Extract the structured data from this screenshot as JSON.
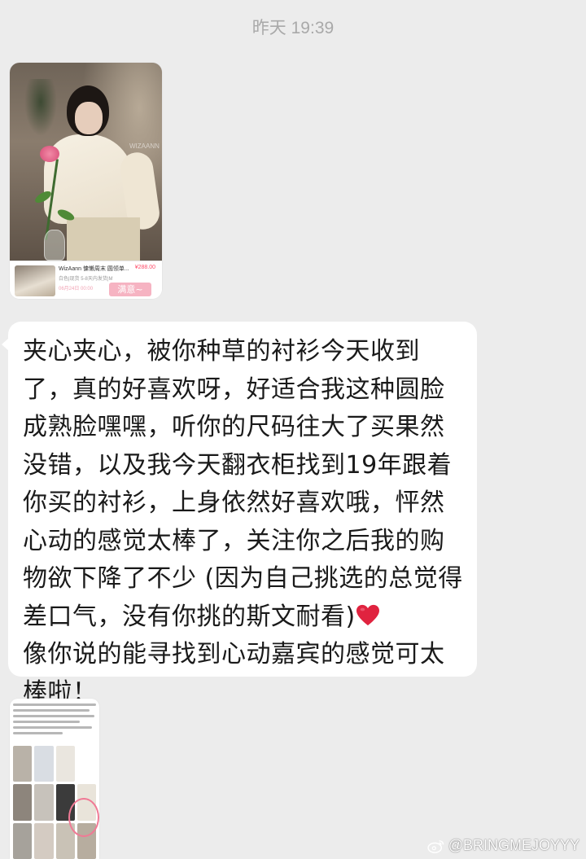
{
  "chat": {
    "timestamp": "昨天 19:39",
    "product_card": {
      "shop_title": "WizAann 慵懒周末 圆领单...",
      "price": "¥288.00",
      "sub_line": "白色|现货 5-8天内发货|M",
      "date_line": "06月24日 00:00",
      "status_label": "满意~",
      "watermark": "WIZAANN"
    },
    "message": {
      "text": "夹心夹心，被你种草的衬衫今天收到了，真的好喜欢呀，好适合我这种圆脸成熟脸嘿嘿，听你的尺码往大了买果然没错，以及我今天翻衣柜找到19年跟着你买的衬衫，上身依然好喜欢哦，怦然心动的感觉太棒了，关注你之后我的购物欲下降了不少 (因为自己挑选的总觉得差口气，没有你挑的斯文耐看)",
      "text_after_heart": "像你说的能寻找到心动嘉宾的感觉可太棒啦！",
      "heart_icon": "red-heart-emoji",
      "heart_color": "#e0233f"
    }
  },
  "watermark": {
    "text": "@BRINGMEJOYYY",
    "icon": "weibo-logo-icon"
  },
  "colors": {
    "background": "#ececec",
    "bubble": "#ffffff",
    "timestamp": "#a9a9a9",
    "text": "#1a1a1a"
  }
}
